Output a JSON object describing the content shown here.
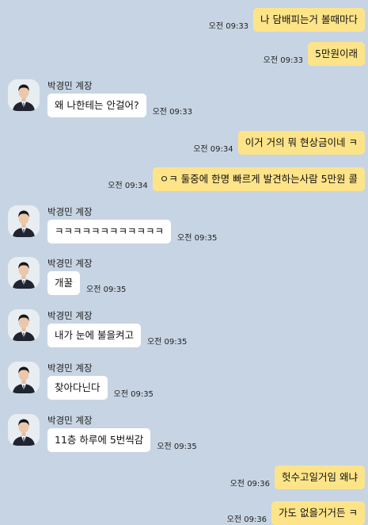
{
  "partner": {
    "name": "박경민 계장"
  },
  "icons": {
    "avatar": "profile-photo-icon"
  },
  "colors": {
    "background": "#c7d4e3",
    "my_bubble": "#fee489",
    "their_bubble": "#ffffff"
  },
  "messages": [
    {
      "text": "나 담배피는거 볼때마다",
      "time": "오전 09:33"
    },
    {
      "text": "5만원이래",
      "time": "오전 09:33"
    },
    {
      "text": "왜 나한테는 안걸어?",
      "time": "오전 09:33"
    },
    {
      "text": "이거 거의 뭐 현상금이네 ㅋ",
      "time": "오전 09:34"
    },
    {
      "text": "ㅇㅋ 둘중에 한명 빠르게 발견하는사람 5만원 콜",
      "time": "오전 09:34"
    },
    {
      "text": "ㅋㅋㅋㅋㅋㅋㅋㅋㅋㅋㅋㅋ",
      "time": "오전 09:35"
    },
    {
      "text": "개꿀",
      "time": "오전 09:35"
    },
    {
      "text": "내가 눈에 불을켜고",
      "time": "오전 09:35"
    },
    {
      "text": "찾아다닌다",
      "time": "오전 09:35"
    },
    {
      "text": "11층 하루에 5번씩감",
      "time": "오전 09:35"
    },
    {
      "text": "헛수고일거임 왜냐",
      "time": "오전 09:36"
    },
    {
      "text": "가도 없을거거든 ㅋ",
      "time": "오전 09:36"
    }
  ]
}
